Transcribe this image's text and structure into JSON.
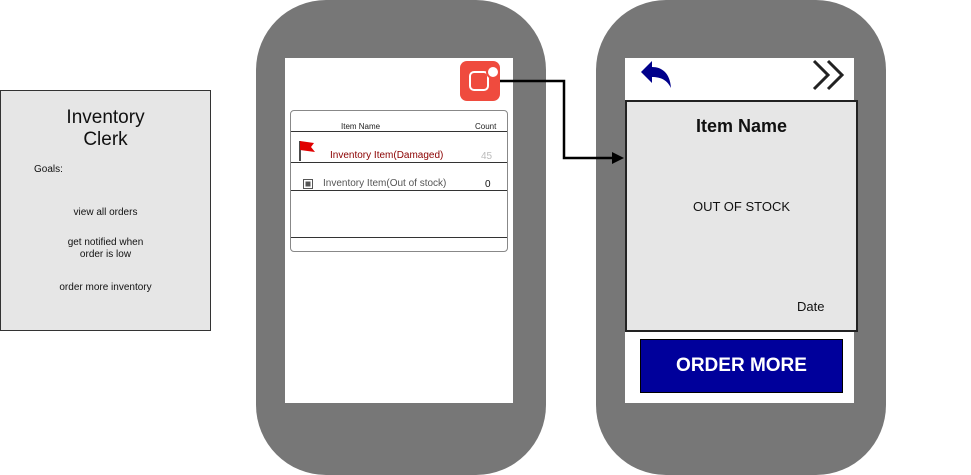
{
  "persona": {
    "title": "Inventory\nClerk",
    "goals_label": "Goals:",
    "goals": [
      "view all orders",
      "get notified when\norder is low",
      "order more inventory"
    ]
  },
  "inventory_list": {
    "col_name": "Item Name",
    "col_count": "Count",
    "rows": [
      {
        "name": "Inventory Item(Damaged)",
        "count": "45",
        "status_icon": "red-flag-icon",
        "color": "#8b0000"
      },
      {
        "name": "Inventory Item(Out of stock)",
        "count": "0",
        "status_icon": "stop-square-icon",
        "color": "#555555"
      }
    ]
  },
  "detail": {
    "title": "Item Name",
    "status": "OUT OF STOCK",
    "date": "Date",
    "order_button": "ORDER MORE"
  },
  "colors": {
    "phone_frame": "#777777",
    "app_icon": "#ef4b3e",
    "order_button": "#00009b",
    "back_arrow": "#00008b"
  },
  "icons": [
    "app-notification-icon",
    "back-arrow-icon",
    "forward-chevrons-icon"
  ]
}
